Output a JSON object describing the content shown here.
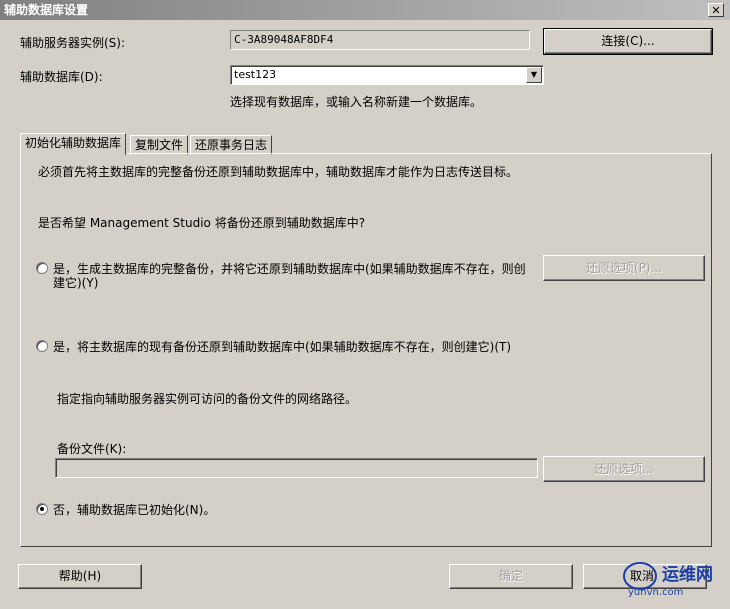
{
  "window": {
    "title": "辅助数据库设置",
    "close_glyph": "✕"
  },
  "server": {
    "label": "辅助服务器实例(S):",
    "value": "C-3A89048AF8DF4",
    "connect_button": "连接(C)..."
  },
  "database": {
    "label": "辅助数据库(D):",
    "value": "test123",
    "hint": "选择现有数据库，或输入名称新建一个数据库。"
  },
  "tabs": [
    {
      "label": "初始化辅助数据库",
      "active": true
    },
    {
      "label": "复制文件",
      "active": false
    },
    {
      "label": "还原事务日志",
      "active": false
    }
  ],
  "panel": {
    "intro": "必须首先将主数据库的完整备份还原到辅助数据库中，辅助数据库才能作为日志传送目标。",
    "question": "是否希望 Management Studio 将备份还原到辅助数据库中?",
    "option1_line1": "是，生成主数据库的完整备份，并将它还原到辅助数据库中(如果辅助数据库不存在，则创",
    "option1_line2": "建它)(Y)",
    "restore_options1": "还原选项(P)...",
    "option2": "是，将主数据库的现有备份还原到辅助数据库中(如果辅助数据库不存在，则创建它)(T)",
    "network_path_hint": "指定指向辅助服务器实例可访问的备份文件的网络路径。",
    "backup_file_label": "备份文件(K):",
    "backup_file_value": "",
    "restore_options2": "还原选项...",
    "option3": "否，辅助数据库已初始化(N)。",
    "selected_option": 3
  },
  "footer": {
    "help": "帮助(H)",
    "ok": "确定",
    "cancel": "取消"
  },
  "watermark": {
    "text": "运维网",
    "url": "yunvn.com"
  }
}
